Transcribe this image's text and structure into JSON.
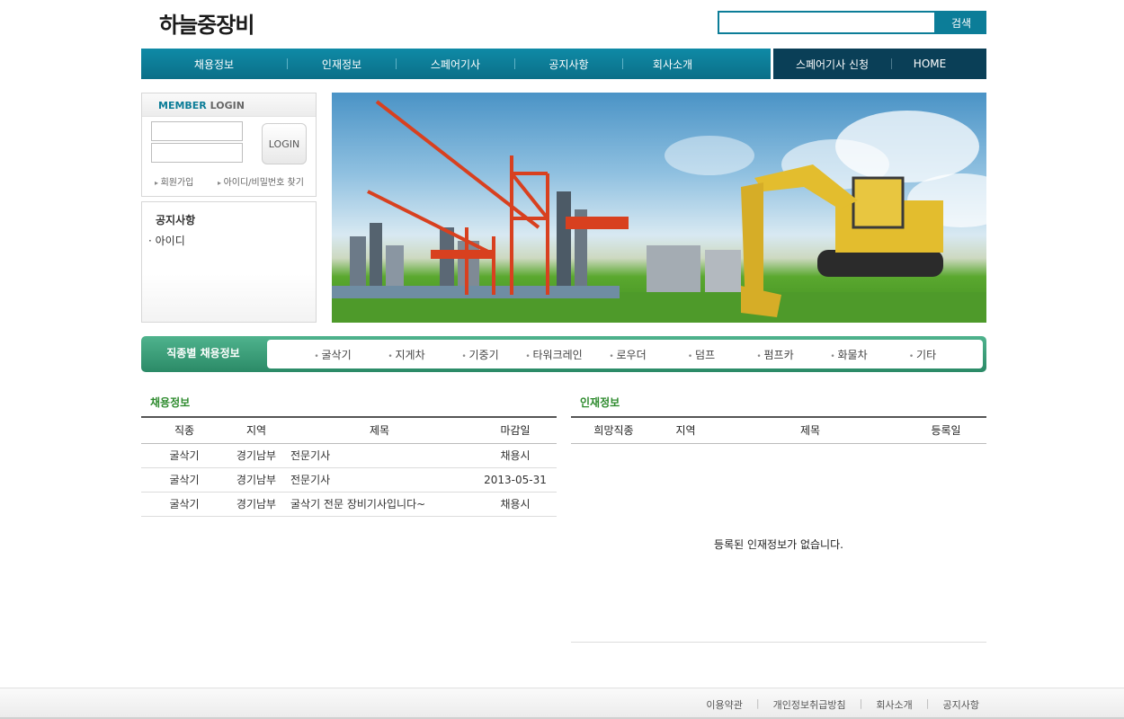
{
  "header": {
    "logo": "하늘중장비",
    "search_placeholder": "",
    "search_button": "검색"
  },
  "nav": {
    "items": [
      "채용정보",
      "인재정보",
      "스페어기사",
      "공지사항",
      "회사소개"
    ],
    "right_items": [
      "스페어기사 신청",
      "HOME"
    ]
  },
  "login": {
    "title_member": "MEMBER",
    "title_login": " LOGIN",
    "button": "LOGIN",
    "link_join": "회원가입",
    "link_find": "아이디/비밀번호 찾기"
  },
  "notice": {
    "title": "공지사항",
    "items": [
      "· 아이디"
    ]
  },
  "category_bar": {
    "label": "직종별 채용정보",
    "items": [
      "굴삭기",
      "지게차",
      "기중기",
      "타워크레인",
      "로우더",
      "덤프",
      "펌프카",
      "화물차",
      "기타"
    ]
  },
  "jobs": {
    "title": "채용정보",
    "columns": [
      "직종",
      "지역",
      "제목",
      "마감일"
    ],
    "rows": [
      [
        "굴삭기",
        "경기남부",
        "전문기사",
        "채용시"
      ],
      [
        "굴삭기",
        "경기남부",
        "전문기사",
        "2013-05-31"
      ],
      [
        "굴삭기",
        "경기남부",
        "굴삭기 전문 장비기사입니다~",
        "채용시"
      ]
    ]
  },
  "talent": {
    "title": "인재정보",
    "columns": [
      "희망직종",
      "지역",
      "제목",
      "등록일"
    ],
    "empty_message": "등록된 인재정보가 없습니다."
  },
  "footer": {
    "links": [
      "이용약관",
      "개인정보취급방침",
      "회사소개",
      "공지사항"
    ]
  },
  "colors": {
    "nav": "#0c7d98",
    "nav_dark": "#0a3f57",
    "category": "#2b8a67",
    "section_title": "#2e8b2e"
  }
}
